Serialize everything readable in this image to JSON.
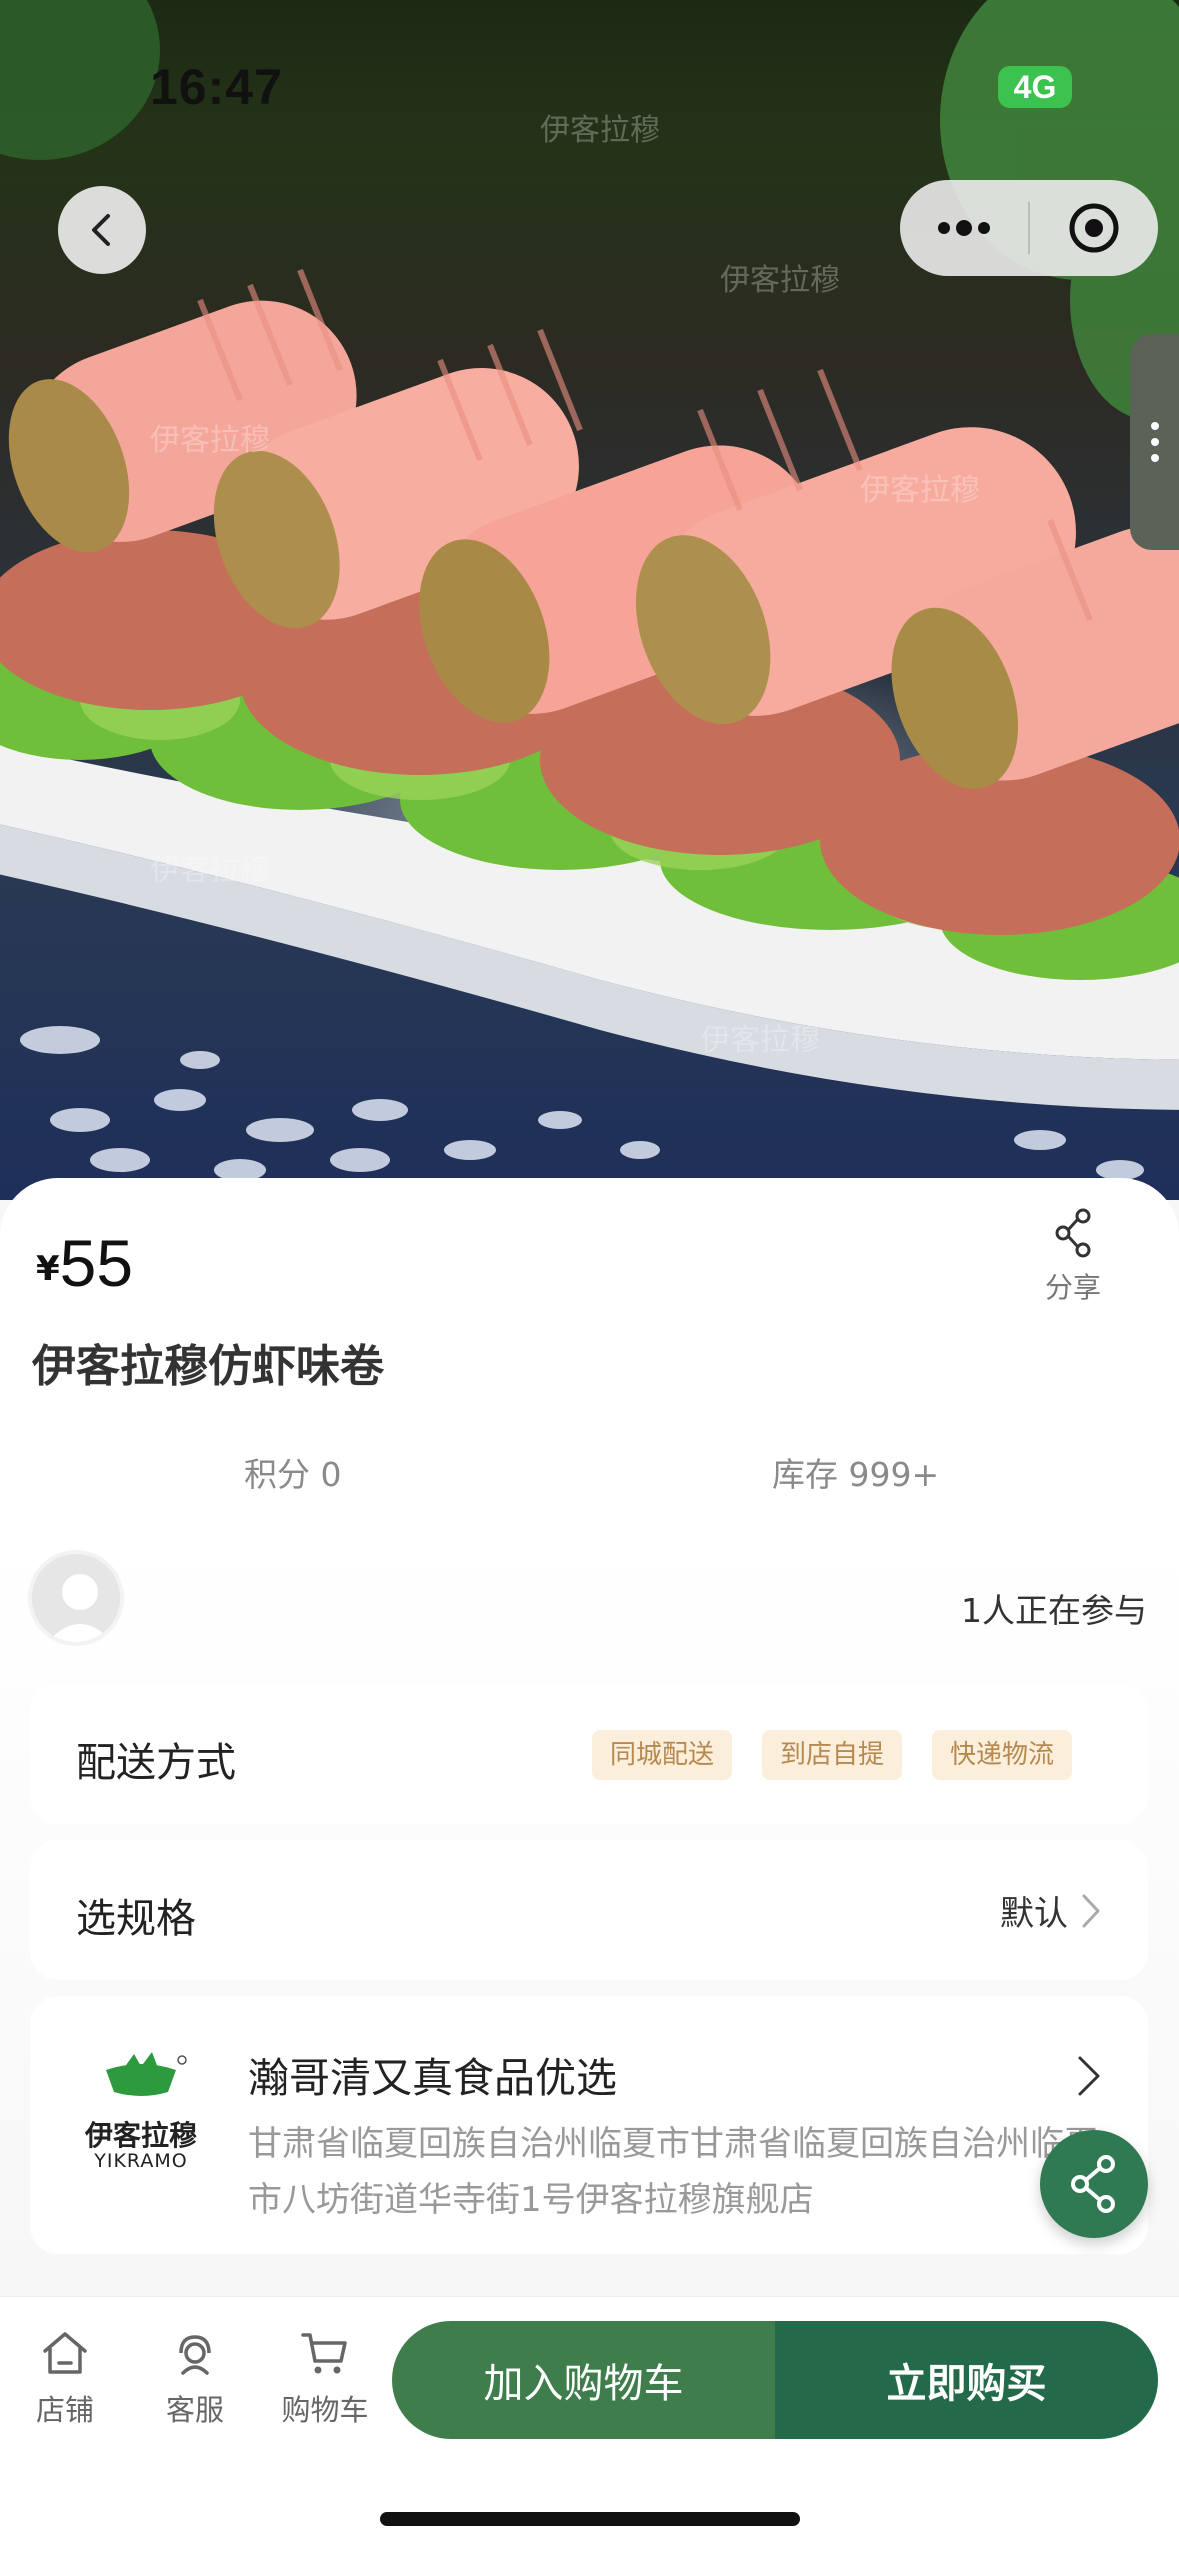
{
  "status_bar": {
    "time": "16:47",
    "network": "4G"
  },
  "colors": {
    "primary_green": "#236a4a",
    "secondary_green": "#3f7d4d",
    "tag_bg": "#fbeedb",
    "tag_text": "#b5894f"
  },
  "product": {
    "currency": "¥",
    "price": "55",
    "title": "伊客拉穆仿虾味卷",
    "share_label": "分享",
    "points_text": "积分 0",
    "stock_text": "库存 999+",
    "participants_text": "1人正在参与"
  },
  "delivery": {
    "label": "配送方式",
    "options": [
      "同城配送",
      "到店自提",
      "快递物流"
    ]
  },
  "spec": {
    "label": "选规格",
    "value": "默认"
  },
  "shop": {
    "logo_brand": "伊客拉穆",
    "logo_brand_en": "YIKRAMO",
    "name": "瀚哥清又真食品优选",
    "address": "甘肃省临夏回族自治州临夏市甘肃省临夏回族自治州临夏市八坊街道华寺街1号伊客拉穆旗舰店"
  },
  "bottom_nav": {
    "shop_label": "店铺",
    "service_label": "客服",
    "cart_label": "购物车",
    "add_to_cart_label": "加入购物车",
    "buy_now_label": "立即购买"
  },
  "hero_watermark": {
    "text": "伊客拉穆",
    "text_en": "YIKRAMO"
  }
}
